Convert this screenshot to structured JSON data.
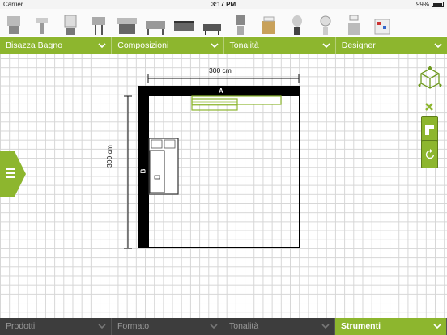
{
  "status": {
    "carrier": "Carrier",
    "time": "3:17 PM",
    "battery": "99%"
  },
  "thumbnails": [
    "lavabo-1",
    "lavabo-2",
    "specchio-1",
    "lavabo-3",
    "mobile-1",
    "mobile-2",
    "vasca-1",
    "mobile-3",
    "specchio-2",
    "mobile-4",
    "sgabello-1",
    "specchio-3",
    "specchio-4",
    "mobile-5"
  ],
  "top_menus": [
    {
      "label": "Bisazza Bagno"
    },
    {
      "label": "Composizioni"
    },
    {
      "label": "Tonalità"
    },
    {
      "label": "Designer"
    }
  ],
  "bottom_menus": [
    {
      "label": "Prodotti"
    },
    {
      "label": "Formato"
    },
    {
      "label": "Tonalità"
    },
    {
      "label": "Strumenti"
    }
  ],
  "plan": {
    "width_label": "300 cm",
    "height_label": "300 cm",
    "wall_a": "A",
    "wall_b": "B"
  },
  "colors": {
    "accent": "#8db62e",
    "bottombar": "#3d3d3d",
    "active": "#8db62e"
  }
}
